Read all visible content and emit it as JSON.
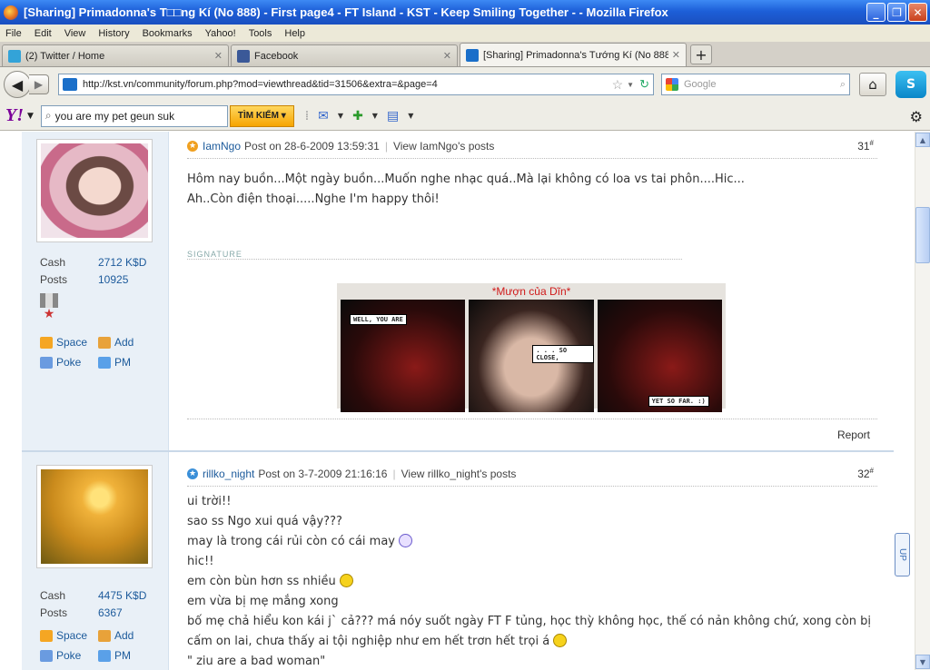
{
  "window": {
    "title": "[Sharing] Primadonna's T□□ng Kí (No 888) - First page4 - FT Island - KST - Keep Smiling Together - - Mozilla Firefox",
    "min": "_",
    "max": "❐",
    "close": "✕"
  },
  "menu": [
    "File",
    "Edit",
    "View",
    "History",
    "Bookmarks",
    "Yahoo!",
    "Tools",
    "Help"
  ],
  "tabs": [
    {
      "label": "(2) Twitter / Home",
      "fav_color": "#33a3d8"
    },
    {
      "label": "Facebook",
      "fav_color": "#3b5998"
    },
    {
      "label": "[Sharing] Primadonna's Tướng Kí (No 888...",
      "fav_color": "#1a6fc9"
    }
  ],
  "newtab": "+",
  "nav": {
    "url": "http://kst.vn/community/forum.php?mod=viewthread&tid=31506&extra=&page=4",
    "search_placeholder": "Google",
    "skype": "S"
  },
  "yahoo": {
    "logo": "Y!",
    "search_value": "you are my pet geun suk",
    "button": "TÌM KIẾM ▾"
  },
  "posts": [
    {
      "author": "IamNgo",
      "posted": "Post on 28-6-2009 13:59:31",
      "view": "View IamNgo's posts",
      "number": "31",
      "status_color": "#f0a020",
      "stats": [
        {
          "k": "Cash",
          "v": "2712 K$D"
        },
        {
          "k": "Posts",
          "v": "10925"
        }
      ],
      "links": [
        [
          "Space",
          "Add"
        ],
        [
          "Poke",
          "PM"
        ]
      ],
      "lines": [
        "Hôm nay buồn...Một ngày buồn...Muốn nghe nhạc quá..Mà lại không có loa vs tai phôn....Hic...",
        "Ah..Còn điện thoại.....Nghe I'm happy thôi!"
      ],
      "signature_label": "SIGNATURE",
      "sig_title": "*Mượn của Dĩn*",
      "bubbles": [
        "WELL, YOU ARE",
        ". . . SO CLOSE,",
        "YET SO FAR. :)"
      ],
      "report": "Report"
    },
    {
      "author": "rillko_night",
      "posted": "Post on 3-7-2009 21:16:16",
      "view": "View rillko_night's posts",
      "number": "32",
      "status_color": "#3a8fd8",
      "stats": [
        {
          "k": "Cash",
          "v": "4475 K$D"
        },
        {
          "k": "Posts",
          "v": "6367"
        }
      ],
      "links": [
        [
          "Space",
          "Add"
        ],
        [
          "Poke",
          "PM"
        ]
      ],
      "lines": [
        "ui trời!!",
        "sao ss Ngo xui quá vậy???",
        "may là trong cái rủi còn có cái may",
        "hic!!",
        "em còn bùn hơn ss nhiều",
        "em vừa bị mẹ mắng xong",
        "bố mẹ chả hiểu kon kái j` cả??? má nóy suốt ngày FT F tủng, học thỳ không học, thế có nản không chứ, xong còn bị",
        "cấm on lai, chưa thấy ai tội nghiệp như em hết trơn hết trọi á",
        "\" ziu are a bad woman\""
      ]
    }
  ],
  "uptop": "UP"
}
